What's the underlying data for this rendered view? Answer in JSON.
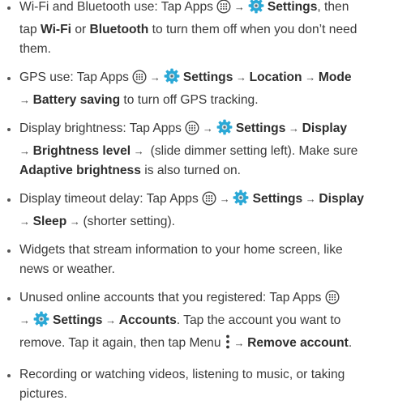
{
  "items": [
    {
      "lines": [
        [
          {
            "t": "text",
            "v": "Wi-Fi and Bluetooth use: Tap Apps "
          },
          {
            "t": "icon",
            "icon": "apps-icon"
          },
          {
            "t": "arrow",
            "v": " → "
          },
          {
            "t": "icon",
            "icon": "settings-icon"
          },
          {
            "t": "bold",
            "v": " Settings"
          },
          {
            "t": "text",
            "v": ", then"
          }
        ],
        [
          {
            "t": "text",
            "v": "tap "
          },
          {
            "t": "bold",
            "v": "Wi-Fi"
          },
          {
            "t": "text",
            "v": " or "
          },
          {
            "t": "bold",
            "v": "Bluetooth"
          },
          {
            "t": "text",
            "v": " to turn them off when you don’t need"
          }
        ],
        [
          {
            "t": "text",
            "v": "them."
          }
        ]
      ]
    },
    {
      "lines": [
        [
          {
            "t": "text",
            "v": "GPS use: Tap Apps "
          },
          {
            "t": "icon",
            "icon": "apps-icon"
          },
          {
            "t": "arrow",
            "v": " → "
          },
          {
            "t": "icon",
            "icon": "settings-icon"
          },
          {
            "t": "bold",
            "v": " Settings"
          },
          {
            "t": "arrow",
            "v": " → "
          },
          {
            "t": "bold",
            "v": "Location"
          },
          {
            "t": "arrow",
            "v": " → "
          },
          {
            "t": "bold",
            "v": "Mode"
          }
        ],
        [
          {
            "t": "arrow",
            "v": "→ "
          },
          {
            "t": "bold",
            "v": "Battery saving"
          },
          {
            "t": "text",
            "v": " to turn off GPS tracking."
          }
        ]
      ]
    },
    {
      "lines": [
        [
          {
            "t": "text",
            "v": "Display brightness: Tap Apps "
          },
          {
            "t": "icon",
            "icon": "apps-icon"
          },
          {
            "t": "arrow",
            "v": " → "
          },
          {
            "t": "icon",
            "icon": "settings-icon"
          },
          {
            "t": "bold",
            "v": " Settings"
          },
          {
            "t": "arrow",
            "v": " → "
          },
          {
            "t": "bold",
            "v": "Display"
          }
        ],
        [
          {
            "t": "arrow",
            "v": "→ "
          },
          {
            "t": "bold",
            "v": "Brightness level"
          },
          {
            "t": "arrow",
            "v": " → "
          },
          {
            "t": "text",
            "v": " (slide dimmer setting left). Make sure"
          }
        ],
        [
          {
            "t": "bold",
            "v": "Adaptive brightness"
          },
          {
            "t": "text",
            "v": " is also turned on."
          }
        ]
      ]
    },
    {
      "lines": [
        [
          {
            "t": "text",
            "v": "Display timeout delay: Tap Apps "
          },
          {
            "t": "icon",
            "icon": "apps-icon"
          },
          {
            "t": "arrow",
            "v": " → "
          },
          {
            "t": "icon",
            "icon": "settings-icon"
          },
          {
            "t": "bold",
            "v": " Settings"
          },
          {
            "t": "arrow",
            "v": " → "
          },
          {
            "t": "bold",
            "v": "Display"
          }
        ],
        [
          {
            "t": "arrow",
            "v": "→ "
          },
          {
            "t": "bold",
            "v": "Sleep"
          },
          {
            "t": "arrow",
            "v": " → "
          },
          {
            "t": "text",
            "v": "(shorter setting)."
          }
        ]
      ]
    },
    {
      "lines": [
        [
          {
            "t": "text",
            "v": "Widgets that stream information to your home screen, like"
          }
        ],
        [
          {
            "t": "text",
            "v": "news or weather."
          }
        ]
      ]
    },
    {
      "lines": [
        [
          {
            "t": "text",
            "v": "Unused online accounts that you registered: Tap Apps "
          },
          {
            "t": "icon",
            "icon": "apps-icon"
          }
        ],
        [
          {
            "t": "arrow",
            "v": "→ "
          },
          {
            "t": "icon",
            "icon": "settings-icon"
          },
          {
            "t": "bold",
            "v": " Settings"
          },
          {
            "t": "arrow",
            "v": " → "
          },
          {
            "t": "bold",
            "v": "Accounts"
          },
          {
            "t": "text",
            "v": ". Tap the account you want to"
          }
        ],
        [
          {
            "t": "text",
            "v": "remove. Tap it again, then tap Menu "
          },
          {
            "t": "icon",
            "icon": "menu-dots-icon"
          },
          {
            "t": "arrow",
            "v": " → "
          },
          {
            "t": "bold",
            "v": "Remove account"
          },
          {
            "t": "text",
            "v": "."
          }
        ]
      ]
    },
    {
      "lines": [
        [
          {
            "t": "text",
            "v": "Recording or watching videos, listening to music, or taking"
          }
        ],
        [
          {
            "t": "text",
            "v": "pictures."
          }
        ]
      ]
    }
  ],
  "colors": {
    "text": "#3a3a3a",
    "icon_stroke": "#444444",
    "gear_fill": "#2aa8d6"
  }
}
